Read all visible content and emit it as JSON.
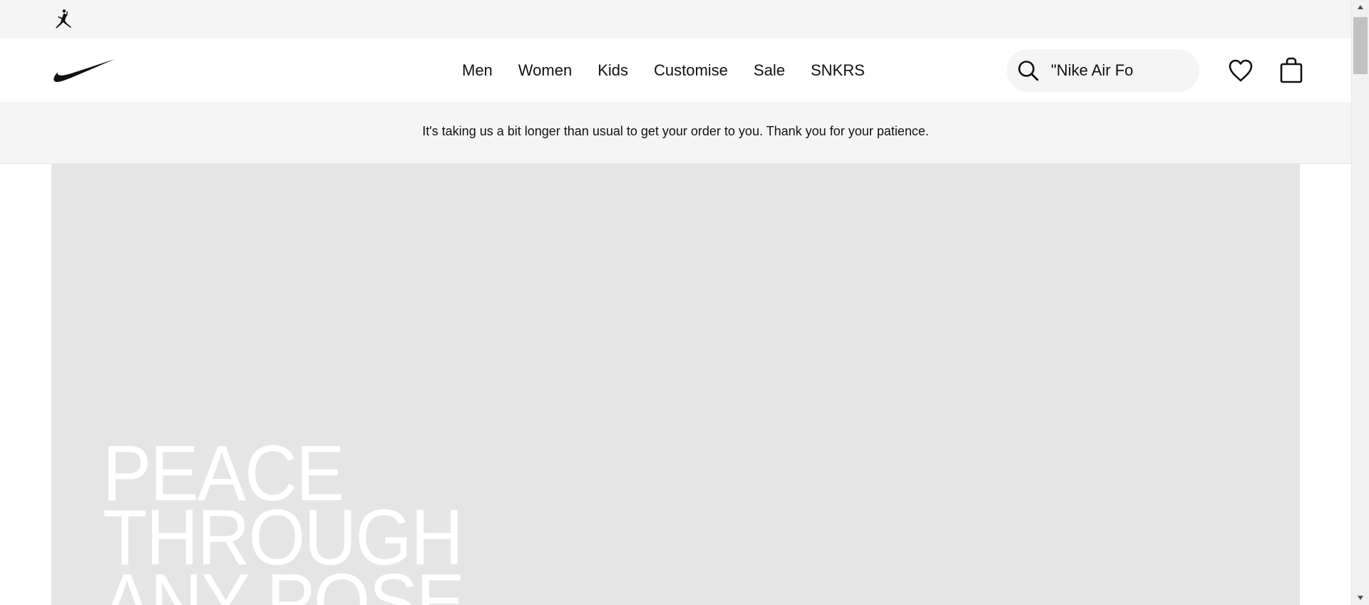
{
  "utility_bar": {
    "logo_icon": "jordan-jumpman-icon"
  },
  "header": {
    "logo_icon": "nike-swoosh-icon",
    "nav": [
      {
        "label": "Men"
      },
      {
        "label": "Women"
      },
      {
        "label": "Kids"
      },
      {
        "label": "Customise"
      },
      {
        "label": "Sale"
      },
      {
        "label": "SNKRS"
      }
    ],
    "search": {
      "icon": "search-icon",
      "value": "\"Nike Air Fo"
    },
    "favourites_icon": "heart-icon",
    "bag_icon": "bag-icon"
  },
  "notice": {
    "text": "It's taking us a bit longer than usual to get your order to you. Thank you for your patience."
  },
  "hero": {
    "headline": "PEACE\nTHROUGH\nANY POSE"
  },
  "colors": {
    "util_bg": "#f5f5f5",
    "hero_bg": "#e5e5e5",
    "text": "#111111",
    "hero_text": "#ffffff"
  }
}
